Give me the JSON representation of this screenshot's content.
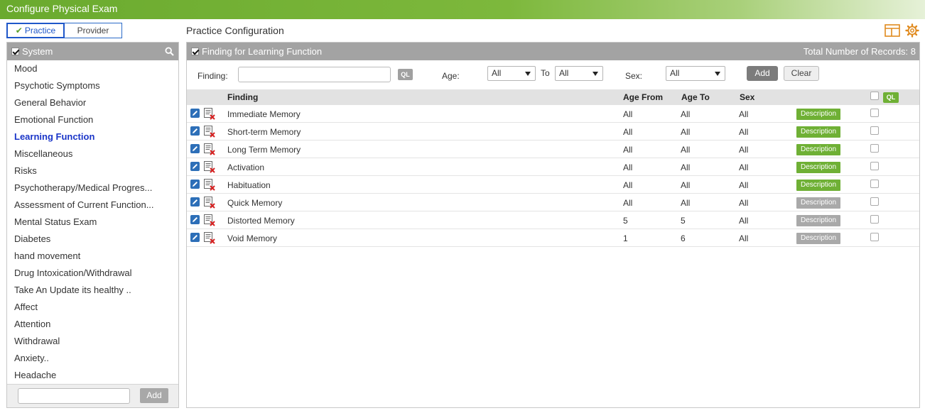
{
  "window": {
    "title": "Configure Physical Exam"
  },
  "toggle": {
    "practice_label": "Practice",
    "provider_label": "Provider",
    "selected": "Practice"
  },
  "sidebar": {
    "header": "System",
    "items": [
      {
        "label": "Mood"
      },
      {
        "label": "Psychotic Symptoms"
      },
      {
        "label": "General Behavior"
      },
      {
        "label": "Emotional Function"
      },
      {
        "label": "Learning Function",
        "active": true
      },
      {
        "label": "Miscellaneous"
      },
      {
        "label": "Risks"
      },
      {
        "label": "Psychotherapy/Medical Progres..."
      },
      {
        "label": "Assessment of Current Function..."
      },
      {
        "label": "Mental Status Exam"
      },
      {
        "label": "Diabetes"
      },
      {
        "label": "hand movement"
      },
      {
        "label": "Drug Intoxication/Withdrawal"
      },
      {
        "label": "Take An Update its healthy .."
      },
      {
        "label": "Affect"
      },
      {
        "label": "Attention"
      },
      {
        "label": "Withdrawal"
      },
      {
        "label": "Anxiety.."
      },
      {
        "label": "Headache"
      }
    ],
    "footer": {
      "input_value": "",
      "add_label": "Add"
    }
  },
  "main": {
    "title": "Practice Configuration",
    "panel_title": "Finding for Learning Function",
    "records_text": "Total Number of Records: 8",
    "filters": {
      "finding_label": "Finding:",
      "finding_value": "",
      "ql_label": "QL",
      "age_label": "Age:",
      "age_from": "All",
      "to_label": "To",
      "age_to": "All",
      "sex_label": "Sex:",
      "sex_value": "All",
      "add_label": "Add",
      "clear_label": "Clear"
    },
    "columns": {
      "finding": "Finding",
      "age_from": "Age From",
      "age_to": "Age To",
      "sex": "Sex",
      "ql": "QL"
    },
    "description_label": "Description",
    "rows": [
      {
        "finding": "Immediate Memory",
        "age_from": "All",
        "age_to": "All",
        "sex": "All",
        "desc_active": true
      },
      {
        "finding": "Short-term Memory",
        "age_from": "All",
        "age_to": "All",
        "sex": "All",
        "desc_active": true
      },
      {
        "finding": "Long Term Memory",
        "age_from": "All",
        "age_to": "All",
        "sex": "All",
        "desc_active": true
      },
      {
        "finding": "Activation",
        "age_from": "All",
        "age_to": "All",
        "sex": "All",
        "desc_active": true
      },
      {
        "finding": "Habituation",
        "age_from": "All",
        "age_to": "All",
        "sex": "All",
        "desc_active": true
      },
      {
        "finding": "Quick Memory",
        "age_from": "All",
        "age_to": "All",
        "sex": "All",
        "desc_active": false
      },
      {
        "finding": "Distorted Memory",
        "age_from": "5",
        "age_to": "5",
        "sex": "All",
        "desc_active": false
      },
      {
        "finding": "Void Memory",
        "age_from": "1",
        "age_to": "6",
        "sex": "All",
        "desc_active": false
      }
    ]
  },
  "colors": {
    "accent_green": "#6fb035",
    "active_link": "#1a35c8",
    "header_gray": "#a3a3a3"
  }
}
